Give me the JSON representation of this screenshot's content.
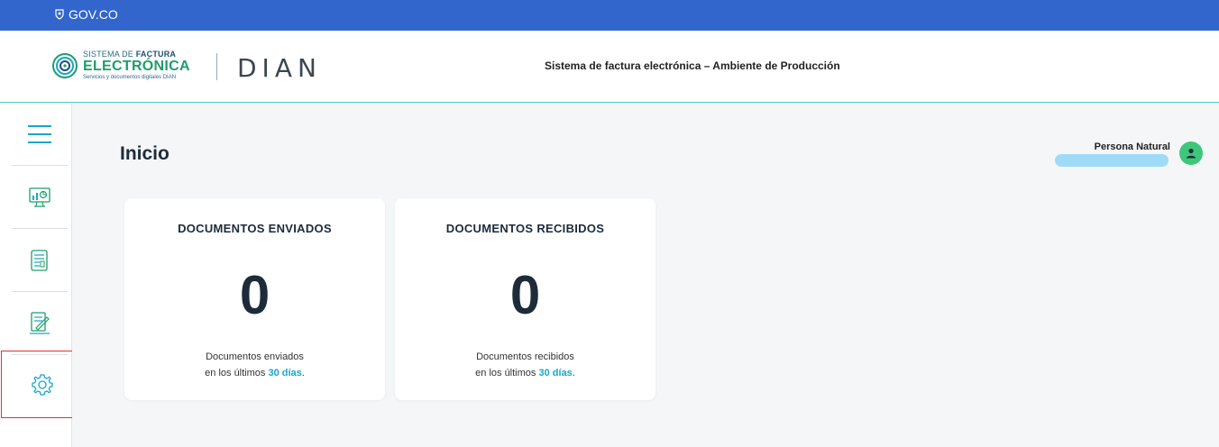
{
  "govbar": {
    "label": "GOV.CO"
  },
  "header": {
    "logo_line1_prefix": "SISTEMA DE ",
    "logo_line1_bold": "FACTURA",
    "logo_line2": "ELECTRÓNICA",
    "logo_line3": "Servicios y documentos digitales DIAN",
    "dian": "DIAN",
    "title": "Sistema de factura electrónica – Ambiente de Producción"
  },
  "sidebar": {
    "items": [
      {
        "icon": "menu-icon"
      },
      {
        "icon": "dashboard-icon"
      },
      {
        "icon": "documents-icon"
      },
      {
        "icon": "edit-document-icon"
      },
      {
        "icon": "gear-icon"
      }
    ]
  },
  "main": {
    "title": "Inicio",
    "user": {
      "type": "Persona Natural",
      "icon": "user-icon"
    },
    "cards": [
      {
        "title": "DOCUMENTOS ENVIADOS",
        "count": "0",
        "desc_line1": "Documentos enviados",
        "desc_line2_prefix": "en los últimos ",
        "desc_days": "30 días",
        "desc_suffix": "."
      },
      {
        "title": "DOCUMENTOS RECIBIDOS",
        "count": "0",
        "desc_line1": "Documentos recibidos",
        "desc_line2_prefix": "en los últimos ",
        "desc_days": "30 días",
        "desc_suffix": "."
      }
    ]
  },
  "colors": {
    "govbar": "#3366cc",
    "accent": "#1aa6c8",
    "logo_green": "#1d9e6b",
    "avatar": "#3dc77a",
    "highlight": "#e03131"
  }
}
